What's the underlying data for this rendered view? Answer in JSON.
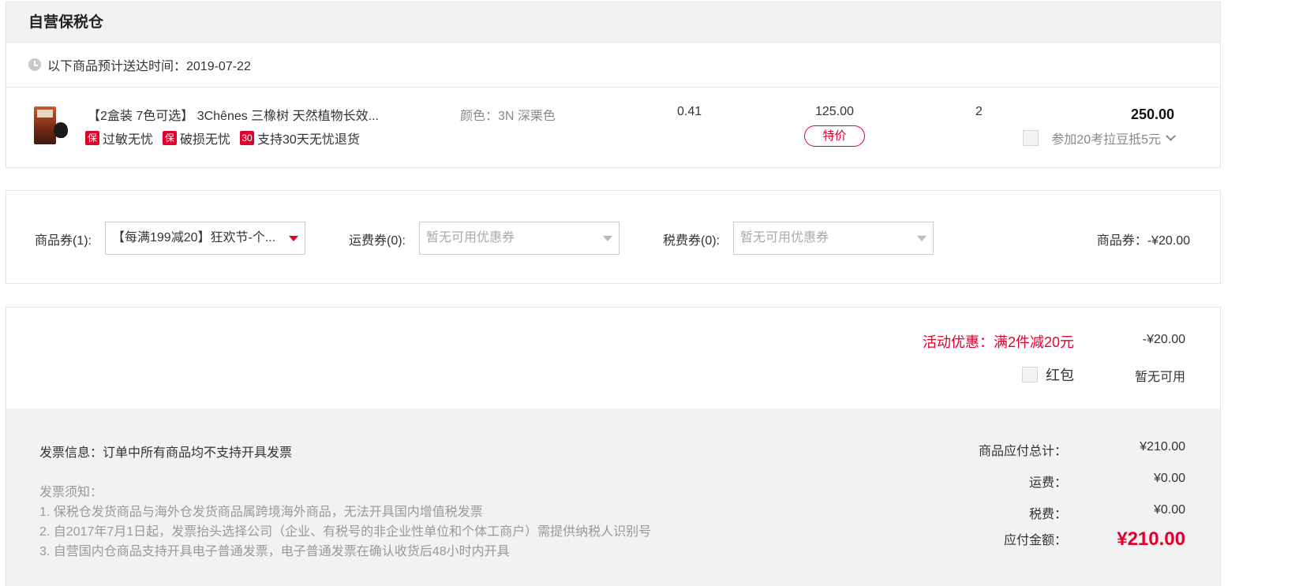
{
  "warehouse": {
    "title": "自营保税仓",
    "eta": "以下商品预计送达时间：2019-07-22"
  },
  "item": {
    "title": "【2盒装 7色可选】 3Chênes 三橡树 天然植物长效...",
    "badges": [
      {
        "tag": "保",
        "label": "过敏无忧"
      },
      {
        "tag": "保",
        "label": "破损无忧"
      },
      {
        "tag": "30",
        "label": "支持30天无忧退货"
      }
    ],
    "color_spec": "颜色：3N 深栗色",
    "weight": "0.41",
    "price": "125.00",
    "price_tag": "特价",
    "quantity": "2",
    "subtotal": "250.00",
    "points_label": "参加20考拉豆抵5元"
  },
  "coupons": {
    "goods_label": "商品券(1):",
    "goods_selected": "【每满199减20】狂欢节-个...",
    "shipping_label": "运费券(0):",
    "shipping_selected": "暂无可用优惠券",
    "tax_label": "税费券(0):",
    "tax_selected": "暂无可用优惠券",
    "summary": "商品券：-¥20.00"
  },
  "promotion": {
    "label": "活动优惠：满2件减20元",
    "amount": "-¥20.00",
    "redpacket_label": "红包",
    "redpacket_value": "暂无可用"
  },
  "invoice": {
    "title": "发票信息：订单中所有商品均不支持开具发票",
    "notes_title": "发票须知：",
    "notes": [
      "1. 保税仓发货商品与海外仓发货商品属跨境海外商品，无法开具国内增值税发票",
      "2. 自2017年7月1日起，发票抬头选择公司（企业、有税号的非企业性单位和个体工商户）需提供纳税人识别号",
      "3. 自营国内仓商品支持开具电子普通发票，电子普通发票在确认收货后48小时内开具"
    ]
  },
  "totals": {
    "goods_label": "商品应付总计：",
    "goods_value": "¥210.00",
    "shipping_label": "运费：",
    "shipping_value": "¥0.00",
    "tax_label": "税费：",
    "tax_value": "¥0.00",
    "payable_label": "应付金额：",
    "payable_value": "¥210.00"
  },
  "colors": {
    "accent": "#e0002a",
    "panel_bg": "#f2f2f2",
    "border": "#e5e5e5"
  }
}
